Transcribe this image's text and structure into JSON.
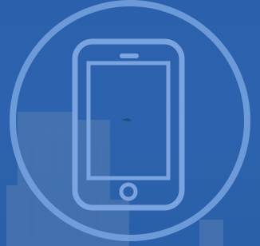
{
  "image": {
    "subject": "smartphone-icon",
    "background_color": "#2a62ad",
    "outline_color": "#78a5e1"
  }
}
